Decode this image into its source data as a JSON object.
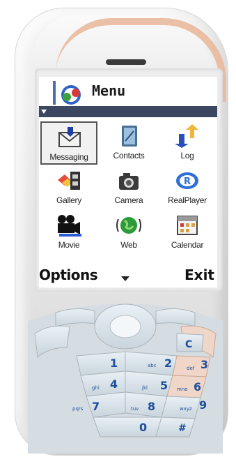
{
  "screen": {
    "title": "Menu",
    "items": [
      {
        "label": "Messaging",
        "icon": "envelope-icon",
        "selected": true
      },
      {
        "label": "Contacts",
        "icon": "contacts-book-icon",
        "selected": false
      },
      {
        "label": "Log",
        "icon": "log-arrows-icon",
        "selected": false
      },
      {
        "label": "Gallery",
        "icon": "gallery-icon",
        "selected": false
      },
      {
        "label": "Camera",
        "icon": "camera-icon",
        "selected": false
      },
      {
        "label": "RealPlayer",
        "icon": "realplayer-icon",
        "selected": false
      },
      {
        "label": "Movie",
        "icon": "movie-camera-icon",
        "selected": false
      },
      {
        "label": "Web",
        "icon": "globe-icon",
        "selected": false
      },
      {
        "label": "Calendar",
        "icon": "calendar-icon",
        "selected": false
      }
    ],
    "softkeys": {
      "left": "Options",
      "right": "Exit"
    }
  },
  "keypad": {
    "keys": [
      "1",
      "2",
      "3",
      "4",
      "5",
      "6",
      "7",
      "8",
      "9",
      "0",
      "#",
      "C"
    ],
    "letters": [
      "abc",
      "def",
      "ghi",
      "jkl",
      "mno",
      "pqrs",
      "tuv",
      "wxyz"
    ]
  },
  "colors": {
    "accent": "#e9b79a",
    "nav_strip": "#3b4660",
    "body": "#e8e8e8"
  }
}
